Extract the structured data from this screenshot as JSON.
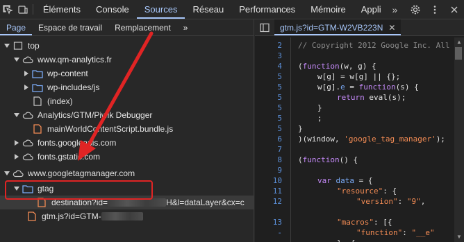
{
  "toolbar": {
    "tabs": [
      "Éléments",
      "Console",
      "Sources",
      "Réseau",
      "Performances",
      "Mémoire",
      "Appli"
    ],
    "active_tab": "Sources"
  },
  "navigator": {
    "subtabs": [
      "Page",
      "Espace de travail",
      "Remplacement"
    ],
    "active_subtab": "Page",
    "tree": {
      "top": "top",
      "qm": "www.qm-analytics.fr",
      "wp_content": "wp-content",
      "wp_includes": "wp-includes/js",
      "index": "(index)",
      "analytics_debugger": "Analytics/GTM/Piwik Debugger",
      "main_world": "mainWorldContentScript.bundle.js",
      "fonts_googleapis": "fonts.googleapis.com",
      "fonts_gstatic": "fonts.gstatic.com",
      "gtm_domain": "www.googletagmanager.com",
      "gtag": "gtag",
      "destination_prefix": "destination?id=",
      "destination_suffix": "H&l=dataLayer&cx=c",
      "gtm_js": "gtm.js?id=GTM-"
    }
  },
  "editor": {
    "file_tab": "gtm.js?id=GTM-W2VB223N",
    "line_numbers": [
      "2",
      "3",
      "4",
      "5",
      "5",
      "5",
      "5",
      "5",
      "5",
      "6",
      "7",
      "8",
      "9",
      "10",
      "11",
      "12",
      "",
      "13",
      "-",
      "-"
    ],
    "code": {
      "l1_comment": "// Copyright 2012 Google Inc. All",
      "l4_kw": "function",
      "l4_rest": "(w, g) {",
      "l5": "w[g] = w[g] || {};",
      "l6_a": "w[g].",
      "l6_e": "e",
      "l6_b": " = ",
      "l6_kw": "function",
      "l6_c": "(s) {",
      "l7_kw": "return",
      "l7_rest": " eval(s);",
      "l8": "}",
      "l9": ";",
      "l10": "}",
      "l11_a": ")(window, ",
      "l11_str": "'google_tag_manager'",
      "l11_b": ");",
      "l13_a": "(",
      "l13_kw": "function",
      "l13_b": "() {",
      "l15_kw": "var",
      "l15_var": " data",
      "l15_b": " = {",
      "l16_str": "\"resource\"",
      "l16_b": ": {",
      "l17_str": "\"version\"",
      "l17_b": ": ",
      "l17_num": "\"9\"",
      "l17_c": ",",
      "l19_str": "\"macros\"",
      "l19_b": ": [{",
      "l20_str": "\"function\"",
      "l20_b": ": ",
      "l20_num": "\"__e\"",
      "l21": "}, {"
    }
  },
  "colors": {
    "accent": "#a8c7fa",
    "highlight_border": "#e02424",
    "annotation_arrow": "#e02424"
  }
}
